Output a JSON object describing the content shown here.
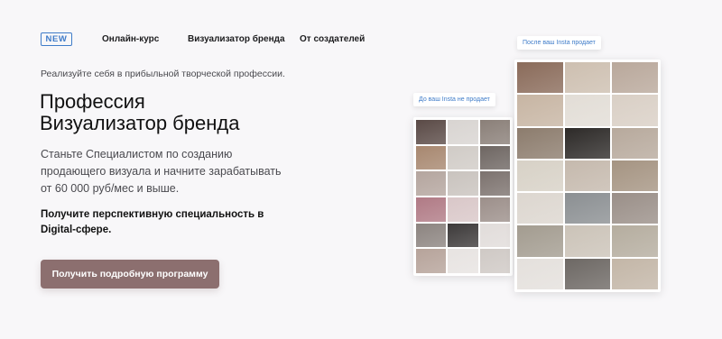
{
  "nav": {
    "badge": "NEW",
    "links": [
      "Онлайн-курс",
      "Визуализатор бренда",
      "От создателей"
    ]
  },
  "hero": {
    "eyebrow": "Реализуйте себя в прибыльной творческой профессии.",
    "title_line1": "Профессия",
    "title_line2": "Визуализатор бренда",
    "lead": "Станьте Специалистом по созданию продающего визуала и начните зарабатывать от 60 000 руб/мес и выше.",
    "strong": "Получите перспективную специальность в Digital-сфере.",
    "cta": "Получить подробную программу"
  },
  "mockups": {
    "before_label": "До ваш Insta не продает",
    "after_label": "После ваш Insta продает",
    "before_tiles": [
      "#5a4a46",
      "#d8d4d1",
      "#8a7f78",
      "#a7876f",
      "#d0cbc6",
      "#6e6662",
      "#b4a59e",
      "#c9c3be",
      "#7c726e",
      "#b07a85",
      "#d9c7c8",
      "#9c8f8a",
      "#8c8480",
      "#3d3a3a",
      "#e1dcda",
      "#b6a39a",
      "#e7e3e1",
      "#cfc9c5"
    ],
    "after_tiles": [
      "#8a6b5a",
      "#cdbfb0",
      "#b9a89b",
      "#c7b5a3",
      "#e2ddd6",
      "#d9cfc5",
      "#8c7c6d",
      "#2d2a28",
      "#b7a99c",
      "#d7d1c6",
      "#c5b9ad",
      "#a59482",
      "#dcd6cf",
      "#8b8f92",
      "#9a8f88",
      "#a39c90",
      "#cbc3b8",
      "#b5ad9f",
      "#e4e0dc",
      "#6d6864",
      "#c3b6a7"
    ]
  }
}
